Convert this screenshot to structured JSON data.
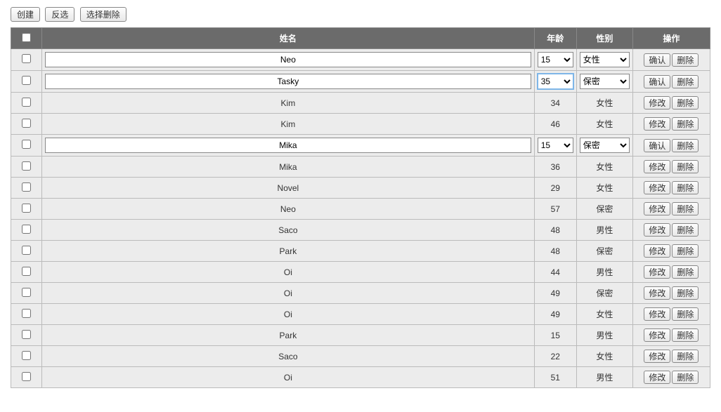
{
  "toolbar": {
    "create": "创建",
    "invert": "反选",
    "del_selected": "选择删除"
  },
  "headers": {
    "name": "姓名",
    "age": "年龄",
    "sex": "性别",
    "ops": "操作"
  },
  "labels": {
    "confirm": "确认",
    "modify": "修改",
    "delete": "删除"
  },
  "rows": [
    {
      "name": "Neo",
      "age": "15",
      "sex": "女性",
      "editing": true,
      "checked": false,
      "age_focus": false
    },
    {
      "name": "Tasky",
      "age": "35",
      "sex": "保密",
      "editing": true,
      "checked": false,
      "age_focus": true
    },
    {
      "name": "Kim",
      "age": "34",
      "sex": "女性",
      "editing": false,
      "checked": false
    },
    {
      "name": "Kim",
      "age": "46",
      "sex": "女性",
      "editing": false,
      "checked": false
    },
    {
      "name": "Mika",
      "age": "15",
      "sex": "保密",
      "editing": true,
      "checked": false,
      "age_focus": false
    },
    {
      "name": "Mika",
      "age": "36",
      "sex": "女性",
      "editing": false,
      "checked": false
    },
    {
      "name": "Novel",
      "age": "29",
      "sex": "女性",
      "editing": false,
      "checked": false
    },
    {
      "name": "Neo",
      "age": "57",
      "sex": "保密",
      "editing": false,
      "checked": false
    },
    {
      "name": "Saco",
      "age": "48",
      "sex": "男性",
      "editing": false,
      "checked": false
    },
    {
      "name": "Park",
      "age": "48",
      "sex": "保密",
      "editing": false,
      "checked": false
    },
    {
      "name": "Oi",
      "age": "44",
      "sex": "男性",
      "editing": false,
      "checked": false
    },
    {
      "name": "Oi",
      "age": "49",
      "sex": "保密",
      "editing": false,
      "checked": false
    },
    {
      "name": "Oi",
      "age": "49",
      "sex": "女性",
      "editing": false,
      "checked": false
    },
    {
      "name": "Park",
      "age": "15",
      "sex": "男性",
      "editing": false,
      "checked": false
    },
    {
      "name": "Saco",
      "age": "22",
      "sex": "女性",
      "editing": false,
      "checked": false
    },
    {
      "name": "Oi",
      "age": "51",
      "sex": "男性",
      "editing": false,
      "checked": false
    }
  ]
}
